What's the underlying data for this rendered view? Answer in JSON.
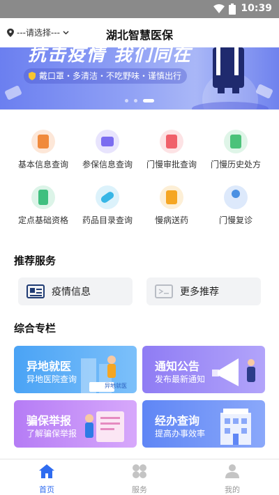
{
  "status_bar": {
    "time": "10:39"
  },
  "header": {
    "location": "---请选择---",
    "title": "湖北智慧医保"
  },
  "banner": {
    "slogan": "抗击疫情 我们同在",
    "tip": "戴口罩・多清洁・不吃野味・谨慎出行"
  },
  "services": [
    {
      "label": "基本信息查询",
      "icon": "document-icon",
      "color": "#f08a3c"
    },
    {
      "label": "参保信息查询",
      "icon": "id-card-icon",
      "color": "#7b6cf0"
    },
    {
      "label": "门慢审批查询",
      "icon": "approval-icon",
      "color": "#f0606a"
    },
    {
      "label": "门慢历史处方",
      "icon": "prescription-icon",
      "color": "#4cc27a"
    },
    {
      "label": "定点基础资格",
      "icon": "building-icon",
      "color": "#3fbf7f"
    },
    {
      "label": "药品目录查询",
      "icon": "pill-icon",
      "color": "#37b6e6"
    },
    {
      "label": "慢病送药",
      "icon": "medicine-box-icon",
      "color": "#f5a623"
    },
    {
      "label": "门慢复诊",
      "icon": "doctor-icon",
      "color": "#4a90e2"
    }
  ],
  "recommended": {
    "title": "推荐服务",
    "items": [
      {
        "label": "疫情信息",
        "icon": "news-icon"
      },
      {
        "label": "更多推荐",
        "icon": "mail-icon"
      }
    ]
  },
  "columns": {
    "title": "综合专栏",
    "items": [
      {
        "title": "异地就医",
        "subtitle": "异地医院查询",
        "art_label": "异地就医",
        "color_start": "#4aa3f5",
        "color_end": "#7cc0fa"
      },
      {
        "title": "通知公告",
        "subtitle": "发布最新通知",
        "color_start": "#8f7cf4",
        "color_end": "#b2a4fa"
      },
      {
        "title": "骗保举报",
        "subtitle": "了解骗保举报",
        "color_start": "#b57cf5",
        "color_end": "#d7a8fb"
      },
      {
        "title": "经办查询",
        "subtitle": "提高办事效率",
        "color_start": "#5f86f5",
        "color_end": "#8aa8fa"
      }
    ]
  },
  "tabbar": [
    {
      "label": "首页",
      "active": true
    },
    {
      "label": "服务",
      "active": false
    },
    {
      "label": "我的",
      "active": false
    }
  ],
  "colors": {
    "primary": "#2f6cf0"
  }
}
